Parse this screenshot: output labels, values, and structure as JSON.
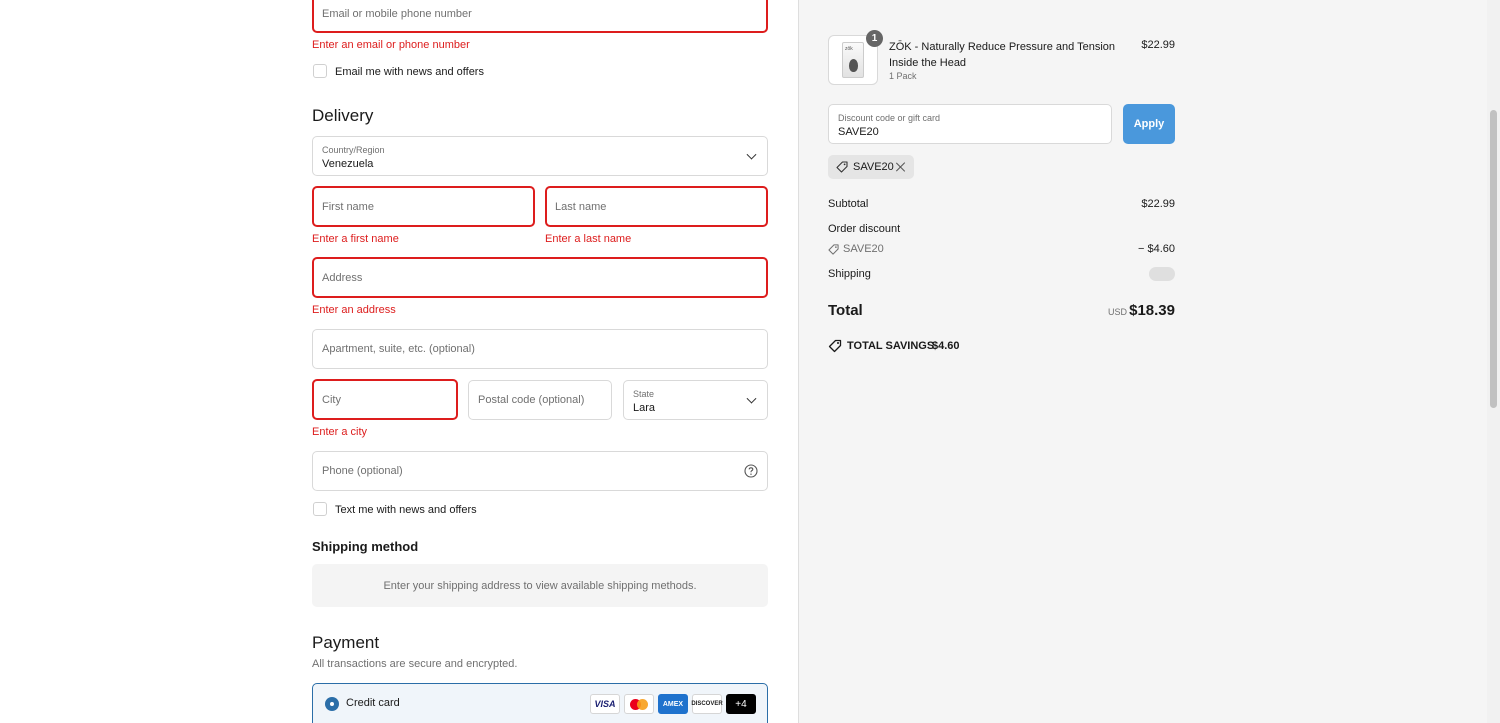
{
  "contact": {
    "email_placeholder": "Email or mobile phone number",
    "email_error": "Enter an email or phone number",
    "news_checkbox_label": "Email me with news and offers"
  },
  "delivery": {
    "title": "Delivery",
    "country_label": "Country/Region",
    "country_value": "Venezuela",
    "first_name_placeholder": "First name",
    "first_name_error": "Enter a first name",
    "last_name_placeholder": "Last name",
    "last_name_error": "Enter a last name",
    "address_placeholder": "Address",
    "address_error": "Enter an address",
    "apartment_placeholder": "Apartment, suite, etc. (optional)",
    "city_placeholder": "City",
    "city_error": "Enter a city",
    "postal_placeholder": "Postal code (optional)",
    "state_label": "State",
    "state_value": "Lara",
    "phone_placeholder": "Phone (optional)",
    "text_checkbox_label": "Text me with news and offers"
  },
  "shipping_method": {
    "title": "Shipping method",
    "message": "Enter your shipping address to view available shipping methods."
  },
  "payment": {
    "title": "Payment",
    "subtitle": "All transactions are secure and encrypted.",
    "method_label": "Credit card",
    "cards": [
      "VISA",
      "AMEX",
      "DISCOVER"
    ],
    "more_cards": "+4"
  },
  "summary": {
    "item": {
      "quantity": "1",
      "name": "ZŌK - Naturally Reduce Pressure and Tension Inside the Head",
      "variant": "1 Pack",
      "price": "$22.99",
      "thumb_brand": "zōk"
    },
    "discount_label": "Discount code or gift card",
    "discount_value": "SAVE20",
    "apply_label": "Apply",
    "applied_code": "SAVE20",
    "subtotal_label": "Subtotal",
    "subtotal_value": "$22.99",
    "order_discount_label": "Order discount",
    "order_discount_code": "SAVE20",
    "order_discount_value": "− $4.60",
    "shipping_label": "Shipping",
    "total_label": "Total",
    "currency": "USD",
    "total_value": "$18.39",
    "savings_label": "TOTAL SAVINGS",
    "savings_value": "$4.60"
  },
  "colors": {
    "error": "#dd1d1d",
    "accent": "#4a98dc",
    "panel_bg": "#f5f5f5"
  }
}
